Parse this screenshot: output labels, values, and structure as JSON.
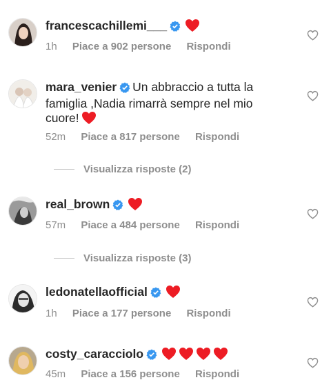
{
  "comments": [
    {
      "username": "francescachillemi___",
      "text": "",
      "hearts": 1,
      "time": "1h",
      "likes": "Piace a 902 persone",
      "reply": "Rispondi"
    },
    {
      "username": "mara_venier",
      "text": "Un abbraccio a tutta la famiglia ,Nadia rimarrà sempre nel mio cuore!",
      "hearts": 1,
      "time": "52m",
      "likes": "Piace a 817 persone",
      "reply": "Rispondi",
      "view_replies": "Visualizza risposte (2)"
    },
    {
      "username": "real_brown",
      "text": "",
      "hearts": 1,
      "time": "57m",
      "likes": "Piace a 484 persone",
      "reply": "Rispondi",
      "view_replies": "Visualizza risposte (3)"
    },
    {
      "username": "ledonatellaofficial",
      "text": "",
      "hearts": 1,
      "time": "1h",
      "likes": "Piace a 177 persone",
      "reply": "Rispondi"
    },
    {
      "username": "costy_caracciolo",
      "text": "",
      "hearts": 4,
      "time": "45m",
      "likes": "Piace a 156 persone",
      "reply": "Rispondi"
    }
  ],
  "colors": {
    "verified": "#3897f0",
    "heart": "#ed1c24",
    "meta": "#8e8e8e",
    "text": "#262626"
  },
  "icons": {
    "verified": "verified-badge-icon",
    "heart_emoji": "red-heart-emoji-icon",
    "like": "heart-outline-icon"
  }
}
